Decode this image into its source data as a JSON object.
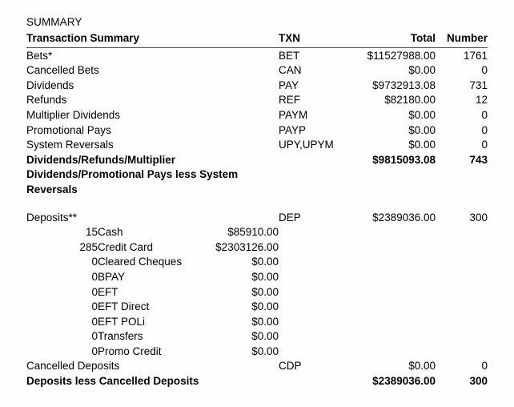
{
  "document": {
    "section_title": "SUMMARY"
  },
  "table": {
    "headers": {
      "label": "Transaction Summary",
      "txn": "TXN",
      "total": "Total",
      "number": "Number"
    },
    "rows": [
      {
        "label": "Bets*",
        "txn": "BET",
        "total": "$11527988.00",
        "number": "1761"
      },
      {
        "label": "Cancelled Bets",
        "txn": "CAN",
        "total": "$0.00",
        "number": "0"
      },
      {
        "label": "Dividends",
        "txn": "PAY",
        "total": "$9732913.08",
        "number": "731"
      },
      {
        "label": "Refunds",
        "txn": "REF",
        "total": "$82180.00",
        "number": "12"
      },
      {
        "label": "Multiplier Dividends",
        "txn": "PAYM",
        "total": "$0.00",
        "number": "0"
      },
      {
        "label": "Promotional Pays",
        "txn": "PAYP",
        "total": "$0.00",
        "number": "0"
      },
      {
        "label": "System Reversals",
        "txn": "UPY,UPYM",
        "total": "$0.00",
        "number": "0"
      }
    ],
    "dividends_total": {
      "label": "Dividends/Refunds/Multiplier Dividends/Promotional Pays less System Reversals",
      "txn": "",
      "total": "$9815093.08",
      "number": "743"
    },
    "deposits": {
      "label": "Deposits**",
      "txn": "DEP",
      "total": "$2389036.00",
      "number": "300",
      "breakdown": [
        {
          "count": "15",
          "label": "Cash",
          "amount": "$85910.00"
        },
        {
          "count": "285",
          "label": "Credit Card",
          "amount": "$2303126.00"
        },
        {
          "count": "0",
          "label": "Cleared Cheques",
          "amount": "$0.00"
        },
        {
          "count": "0",
          "label": "BPAY",
          "amount": "$0.00"
        },
        {
          "count": "0",
          "label": "EFT",
          "amount": "$0.00"
        },
        {
          "count": "0",
          "label": "EFT Direct",
          "amount": "$0.00"
        },
        {
          "count": "0",
          "label": "EFT POLi",
          "amount": "$0.00"
        },
        {
          "count": "0",
          "label": "Transfers",
          "amount": "$0.00"
        },
        {
          "count": "0",
          "label": "Promo Credit",
          "amount": "$0.00"
        }
      ]
    },
    "cancelled_deposits": {
      "label": "Cancelled Deposits",
      "txn": "CDP",
      "total": "$0.00",
      "number": "0"
    },
    "deposits_net": {
      "label": "Deposits less Cancelled Deposits",
      "txn": "",
      "total": "$2389036.00",
      "number": "300"
    }
  }
}
